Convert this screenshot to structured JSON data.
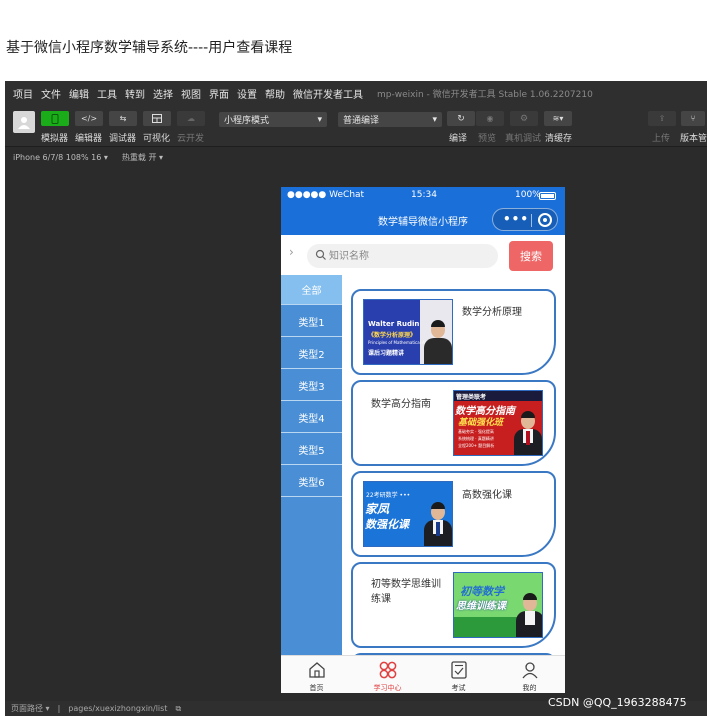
{
  "page": {
    "title": "基于微信小程序数学辅导系统----用户查看课程"
  },
  "ide": {
    "menu": [
      "项目",
      "文件",
      "编辑",
      "工具",
      "转到",
      "选择",
      "视图",
      "界面",
      "设置",
      "帮助",
      "微信开发者工具"
    ],
    "window_title": "mp-weixin - 微信开发者工具 Stable 1.06.2207210",
    "toolbar": {
      "simulator": "模拟器",
      "editor": "编辑器",
      "debugger": "调试器",
      "visual": "可视化",
      "cloud": "云开发",
      "mode_select": "小程序模式",
      "compile_select": "普通编译",
      "compile": "编译",
      "preview": "预览",
      "real_debug": "真机调试",
      "clear_cache": "清缓存",
      "upload": "上传",
      "version": "版本管"
    },
    "device": "iPhone 6/7/8 108% 16 ▾",
    "hot_reload": "热重载 开 ▾",
    "statusbar": {
      "path_label": "页面路径 ▾",
      "path": "pages/xuexizhongxin/list"
    }
  },
  "watermark": "CSDN @QQ_1963288475",
  "phone": {
    "status": {
      "carrier": "●●●●● WeChat",
      "time": "15:34",
      "battery": "100%"
    },
    "nav_title": "数学辅导微信小程序",
    "search": {
      "placeholder": "知识名称",
      "value": "",
      "button": "搜索"
    },
    "categories": [
      "全部",
      "类型1",
      "类型2",
      "类型3",
      "类型4",
      "类型5",
      "类型6"
    ],
    "active_category": "全部",
    "courses": [
      {
        "name": "数学分析原理",
        "cover_title": "Walter Rudin",
        "cover_subtitle": "《数学分析原理》",
        "cover_en": "Principles of Mathematical Analysis",
        "cover_tag": "课后习题精讲"
      },
      {
        "name": "数学高分指南",
        "cover_title": "管理类联考",
        "cover_subtitle": "数学高分指南",
        "cover_tag": "基础强化班",
        "cover_notes": "基础夯实 · 强化提高",
        "cover_notes2": "系统梳理 · 真题精讲",
        "cover_notes3": "全程200+ 题目解析"
      },
      {
        "name": "高数强化课",
        "cover_title": "22考研数学 •••",
        "cover_subtitle": "家凤",
        "cover_tag": "数强化课"
      },
      {
        "name": "初等数学思维训练课",
        "cover_title": "初等数学",
        "cover_tag": "思维训练课"
      }
    ],
    "tabs": [
      {
        "label": "首页",
        "icon": "home-icon"
      },
      {
        "label": "学习中心",
        "icon": "grid-icon"
      },
      {
        "label": "考试",
        "icon": "exam-icon"
      },
      {
        "label": "我的",
        "icon": "user-icon"
      }
    ],
    "active_tab": "学习中心",
    "colors": {
      "nav": "#1a6fd8",
      "category": "#4a8fd6",
      "category_active": "#84bfef",
      "search_button": "#ee6666",
      "card_border": "#3a78c4",
      "tab_active": "#e04040"
    }
  }
}
